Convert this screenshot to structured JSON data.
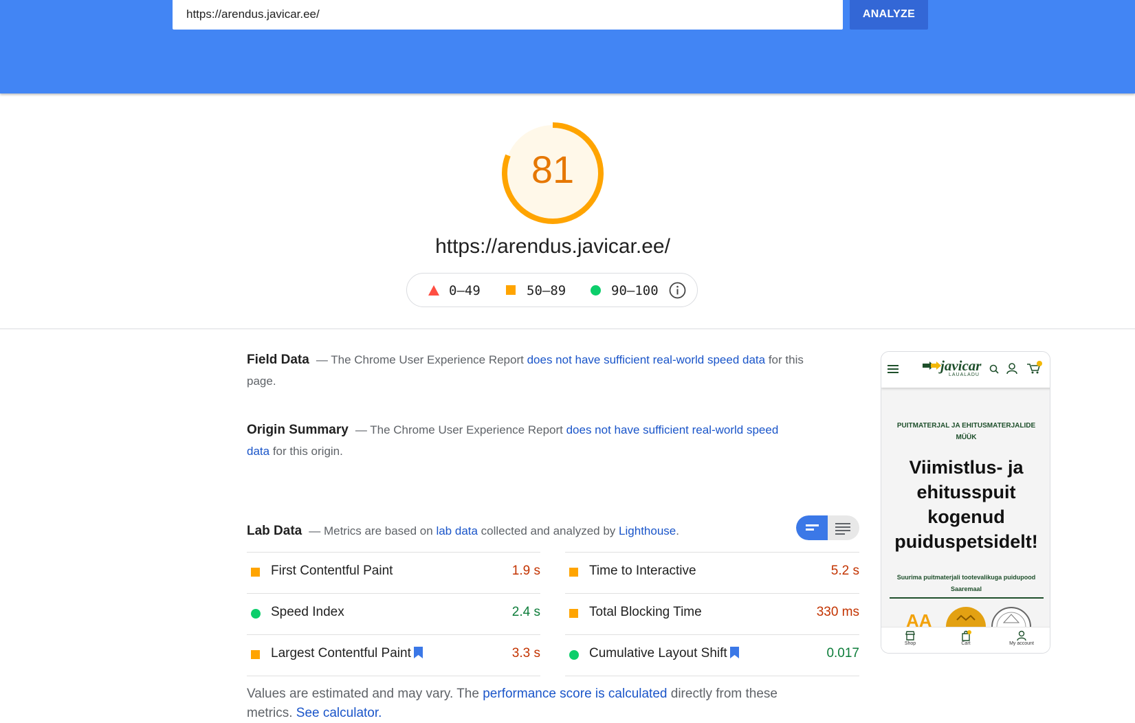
{
  "header": {
    "url_value": "https://arendus.javicar.ee/",
    "analyze_label": "ANALYZE"
  },
  "score": {
    "value": "81",
    "fraction": 0.81,
    "color": "#ffa400",
    "url": "https://arendus.javicar.ee/"
  },
  "legend": {
    "poor": "0–49",
    "average": "50–89",
    "good": "90–100",
    "poor_color": "#ff4e42",
    "average_color": "#ffa400",
    "good_color": "#0cce6b",
    "info_icon": "info-icon"
  },
  "field_data": {
    "title": "Field Data",
    "text_before": "— The Chrome User Experience Report ",
    "link": "does not have sufficient real-world speed data",
    "text_after": " for this page."
  },
  "origin_summary": {
    "title": "Origin Summary",
    "text_before": "— The Chrome User Experience Report ",
    "link": "does not have sufficient real-world speed data",
    "text_after": " for this origin."
  },
  "lab_data": {
    "title": "Lab Data",
    "text_before": "— Metrics are based on ",
    "link_lab": "lab data",
    "text_middle": " collected and analyzed by ",
    "link_lighthouse": "Lighthouse",
    "text_after": "."
  },
  "metrics_left": [
    {
      "label": "First Contentful Paint",
      "value": "1.9 s",
      "status": "average"
    },
    {
      "label": "Speed Index",
      "value": "2.4 s",
      "status": "good"
    },
    {
      "label": "Largest Contentful Paint",
      "value": "3.3 s",
      "status": "average"
    }
  ],
  "metrics_right": [
    {
      "label": "Time to Interactive",
      "value": "5.2 s",
      "status": "average"
    },
    {
      "label": "Total Blocking Time",
      "value": "330 ms",
      "status": "average"
    },
    {
      "label": "Cumulative Layout Shift",
      "value": "0.017",
      "status": "good"
    }
  ],
  "disclaimer": {
    "text_before": "Values are estimated and may vary. The ",
    "link_score": "performance score is calculated",
    "text_middle": " directly from these metrics. ",
    "link_calculator": "See calculator."
  },
  "thumbnail": {
    "logo_text": "javicar",
    "logo_sub": "LAUALADU",
    "eyebrow": "PUITMATERJAL JA EHITUSMATERJALIDE MÜÜK",
    "headline": "Viimistlus- ja ehitusspuit kogenud puiduspetsidelt!",
    "sub": "Suurima puitmaterjali tootevalikuga puidupood Saaremaal",
    "nav_shop": "Shop",
    "nav_cart": "Cart",
    "nav_account": "My account",
    "cart_count": "0"
  }
}
